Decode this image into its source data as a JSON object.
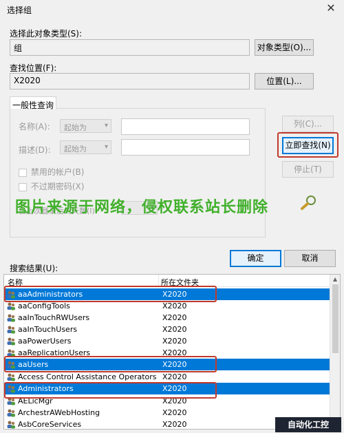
{
  "window": {
    "title": "选择组",
    "close_glyph": "✕"
  },
  "object_type": {
    "label": "选择此对象类型(S):",
    "value": "组",
    "button": "对象类型(O)..."
  },
  "location": {
    "label": "查找位置(F):",
    "value": "X2020",
    "button": "位置(L)..."
  },
  "query": {
    "tab_label": "一般性查询",
    "name_label": "名称(A):",
    "name_mode": "起始为",
    "desc_label": "描述(D):",
    "desc_mode": "起始为",
    "disabled_accounts": "禁用的帐户(B)",
    "no_expire_pw": "不过期密码(X)",
    "last_logon_label": "自上次登录后的天数(I):",
    "columns_button": "列(C)...",
    "find_now_button": "立即查找(N)",
    "stop_button": "停止(T)"
  },
  "watermark": "图片来源于网络，侵权联系站长删除",
  "ok_button": "确定",
  "cancel_button": "取消",
  "results": {
    "label": "搜索结果(U):",
    "columns": [
      "名称",
      "所在文件夹"
    ],
    "rows": [
      {
        "name": "aaAdministrators",
        "folder": "X2020",
        "selected": true
      },
      {
        "name": "aaConfigTools",
        "folder": "X2020",
        "selected": false
      },
      {
        "name": "aaInTouchRWUsers",
        "folder": "X2020",
        "selected": false
      },
      {
        "name": "aaInTouchUsers",
        "folder": "X2020",
        "selected": false
      },
      {
        "name": "aaPowerUsers",
        "folder": "X2020",
        "selected": false
      },
      {
        "name": "aaReplicationUsers",
        "folder": "X2020",
        "selected": false
      },
      {
        "name": "aaUsers",
        "folder": "X2020",
        "selected": true
      },
      {
        "name": "Access Control Assistance Operators",
        "folder": "X2020",
        "selected": false
      },
      {
        "name": "Administrators",
        "folder": "X2020",
        "selected": true
      },
      {
        "name": "AELicMgr",
        "folder": "X2020",
        "selected": false
      },
      {
        "name": "ArchestrAWebHosting",
        "folder": "X2020",
        "selected": false
      },
      {
        "name": "AsbCoreServices",
        "folder": "X2020",
        "selected": false
      }
    ]
  },
  "corner_logo": "自动化工控",
  "colors": {
    "selection": "#0078d7",
    "highlight_box": "#c0392b",
    "watermark": "#41b02b"
  }
}
